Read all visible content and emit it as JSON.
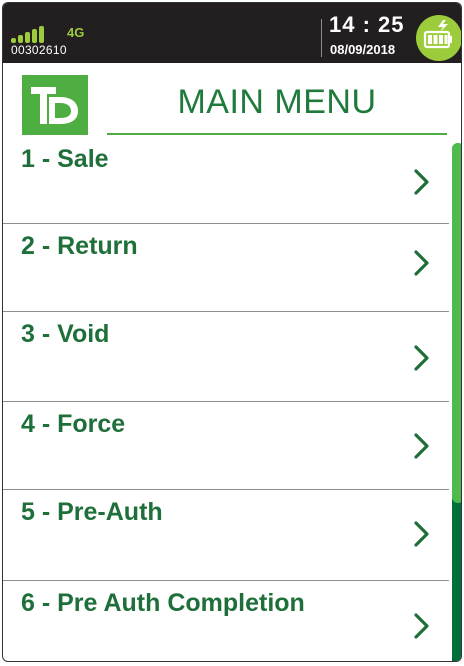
{
  "status_bar": {
    "network": "4G",
    "terminal_id": "00302610",
    "time": "14 : 25",
    "date": "08/09/2018",
    "signal_icon": "signal-bars-icon",
    "battery_icon": "battery-charging-icon",
    "accent_color": "#9ccb3b"
  },
  "header": {
    "logo_text": "TD",
    "title": "MAIN MENU",
    "brand_color": "#4fae42",
    "title_color": "#1f7a3c"
  },
  "menu": {
    "items": [
      {
        "label": "1 - Sale",
        "icon": "chevron-right-icon"
      },
      {
        "label": "2 - Return",
        "icon": "chevron-right-icon"
      },
      {
        "label": "3 - Void",
        "icon": "chevron-right-icon"
      },
      {
        "label": "4 - Force",
        "icon": "chevron-right-icon"
      },
      {
        "label": "5 - Pre-Auth",
        "icon": "chevron-right-icon"
      },
      {
        "label": "6 - Pre Auth Completion",
        "icon": "chevron-right-icon"
      }
    ],
    "item_text_color": "#1f6f3a"
  },
  "scrollbar": {
    "thumb_color": "#4fbb4c",
    "track_color": "#006f3c"
  }
}
